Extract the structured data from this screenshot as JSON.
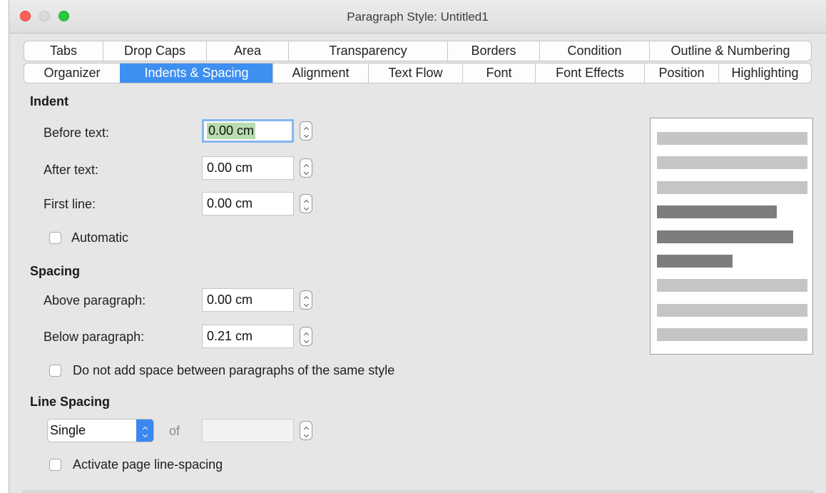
{
  "window": {
    "title": "Paragraph Style: Untitled1"
  },
  "tabs": {
    "row1": [
      "Tabs",
      "Drop Caps",
      "Area",
      "Transparency",
      "Borders",
      "Condition",
      "Outline & Numbering"
    ],
    "row2": [
      "Organizer",
      "Indents & Spacing",
      "Alignment",
      "Text Flow",
      "Font",
      "Font Effects",
      "Position",
      "Highlighting"
    ],
    "active": "Indents & Spacing"
  },
  "indent": {
    "heading": "Indent",
    "before_text": {
      "label": "Before text:",
      "value": "0.00 cm"
    },
    "after_text": {
      "label": "After text:",
      "value": "0.00 cm"
    },
    "first_line": {
      "label": "First line:",
      "value": "0.00 cm"
    },
    "automatic": {
      "label": "Automatic",
      "checked": false
    }
  },
  "spacing": {
    "heading": "Spacing",
    "above": {
      "label": "Above paragraph:",
      "value": "0.00 cm"
    },
    "below": {
      "label": "Below paragraph:",
      "value": "0.21 cm"
    },
    "no_space_same_style": {
      "label": "Do not add space between paragraphs of the same style",
      "checked": false
    }
  },
  "line_spacing": {
    "heading": "Line Spacing",
    "mode": "Single",
    "of_label": "of",
    "value": "",
    "page_line_spacing": {
      "label": "Activate page line-spacing",
      "checked": false
    }
  },
  "colors": {
    "accent": "#3d8ff0",
    "selection": "#b9dcb0",
    "preview_light": "#c5c5c5",
    "preview_dark": "#7d7d7d"
  }
}
